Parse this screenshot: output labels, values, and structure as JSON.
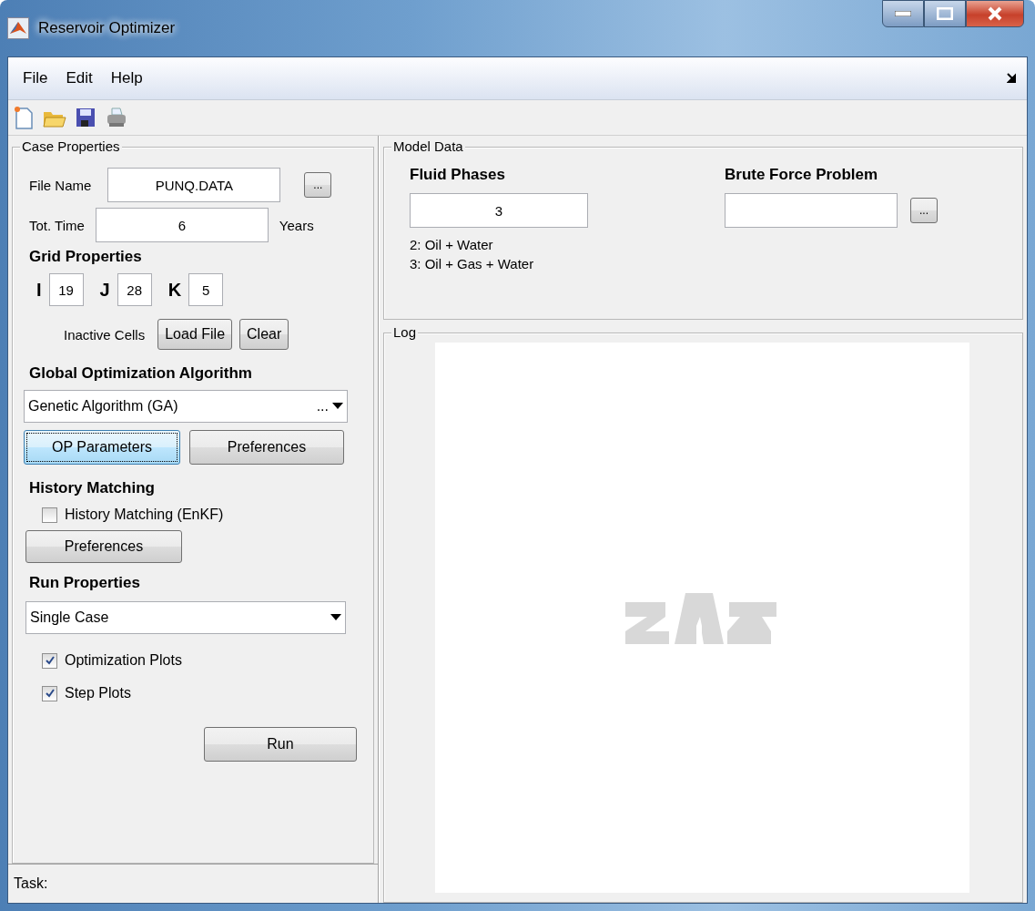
{
  "window": {
    "title": "Reservoir Optimizer"
  },
  "menu": [
    "File",
    "Edit",
    "Help"
  ],
  "case_properties": {
    "title": "Case Properties",
    "file_name": {
      "label": "File Name",
      "value": "PUNQ.DATA",
      "browse": "..."
    },
    "tot_time": {
      "label": "Tot. Time",
      "value": "6",
      "unit": "Years"
    },
    "grid": {
      "title": "Grid Properties",
      "dims": [
        {
          "label": "I",
          "value": "19"
        },
        {
          "label": "J",
          "value": "28"
        },
        {
          "label": "K",
          "value": "5"
        }
      ]
    },
    "inactive_cells": {
      "label": "Inactive Cells",
      "buttons": [
        "Load File",
        "Clear"
      ]
    },
    "algorithm": {
      "title": "Global Optimization Algorithm",
      "value": "Genetic Algorithm (GA)",
      "ellipsis": "...",
      "buttons": [
        {
          "label": "OP Parameters",
          "focused": true
        },
        {
          "label": "Preferences",
          "focused": false
        }
      ]
    },
    "history": {
      "title": "History Matching",
      "checkbox": {
        "label": "History Matching (EnKF)",
        "checked": false
      },
      "button": "Preferences"
    },
    "run": {
      "title": "Run Properties",
      "value": "Single Case",
      "options": [
        {
          "label": "Optimization Plots",
          "checked": true
        },
        {
          "label": "Step Plots",
          "checked": true
        }
      ],
      "button": "Run"
    }
  },
  "status_bar": {
    "text": "Task:"
  },
  "model_data": {
    "title": "Model Data",
    "fluid_phases": {
      "title": "Fluid Phases",
      "value": "3",
      "notes": [
        "2: Oil + Water",
        "3: Oil + Gas + Water"
      ]
    },
    "brute_force": {
      "title": "Brute Force Problem",
      "browse": "..."
    }
  },
  "log": {
    "title": "Log"
  }
}
